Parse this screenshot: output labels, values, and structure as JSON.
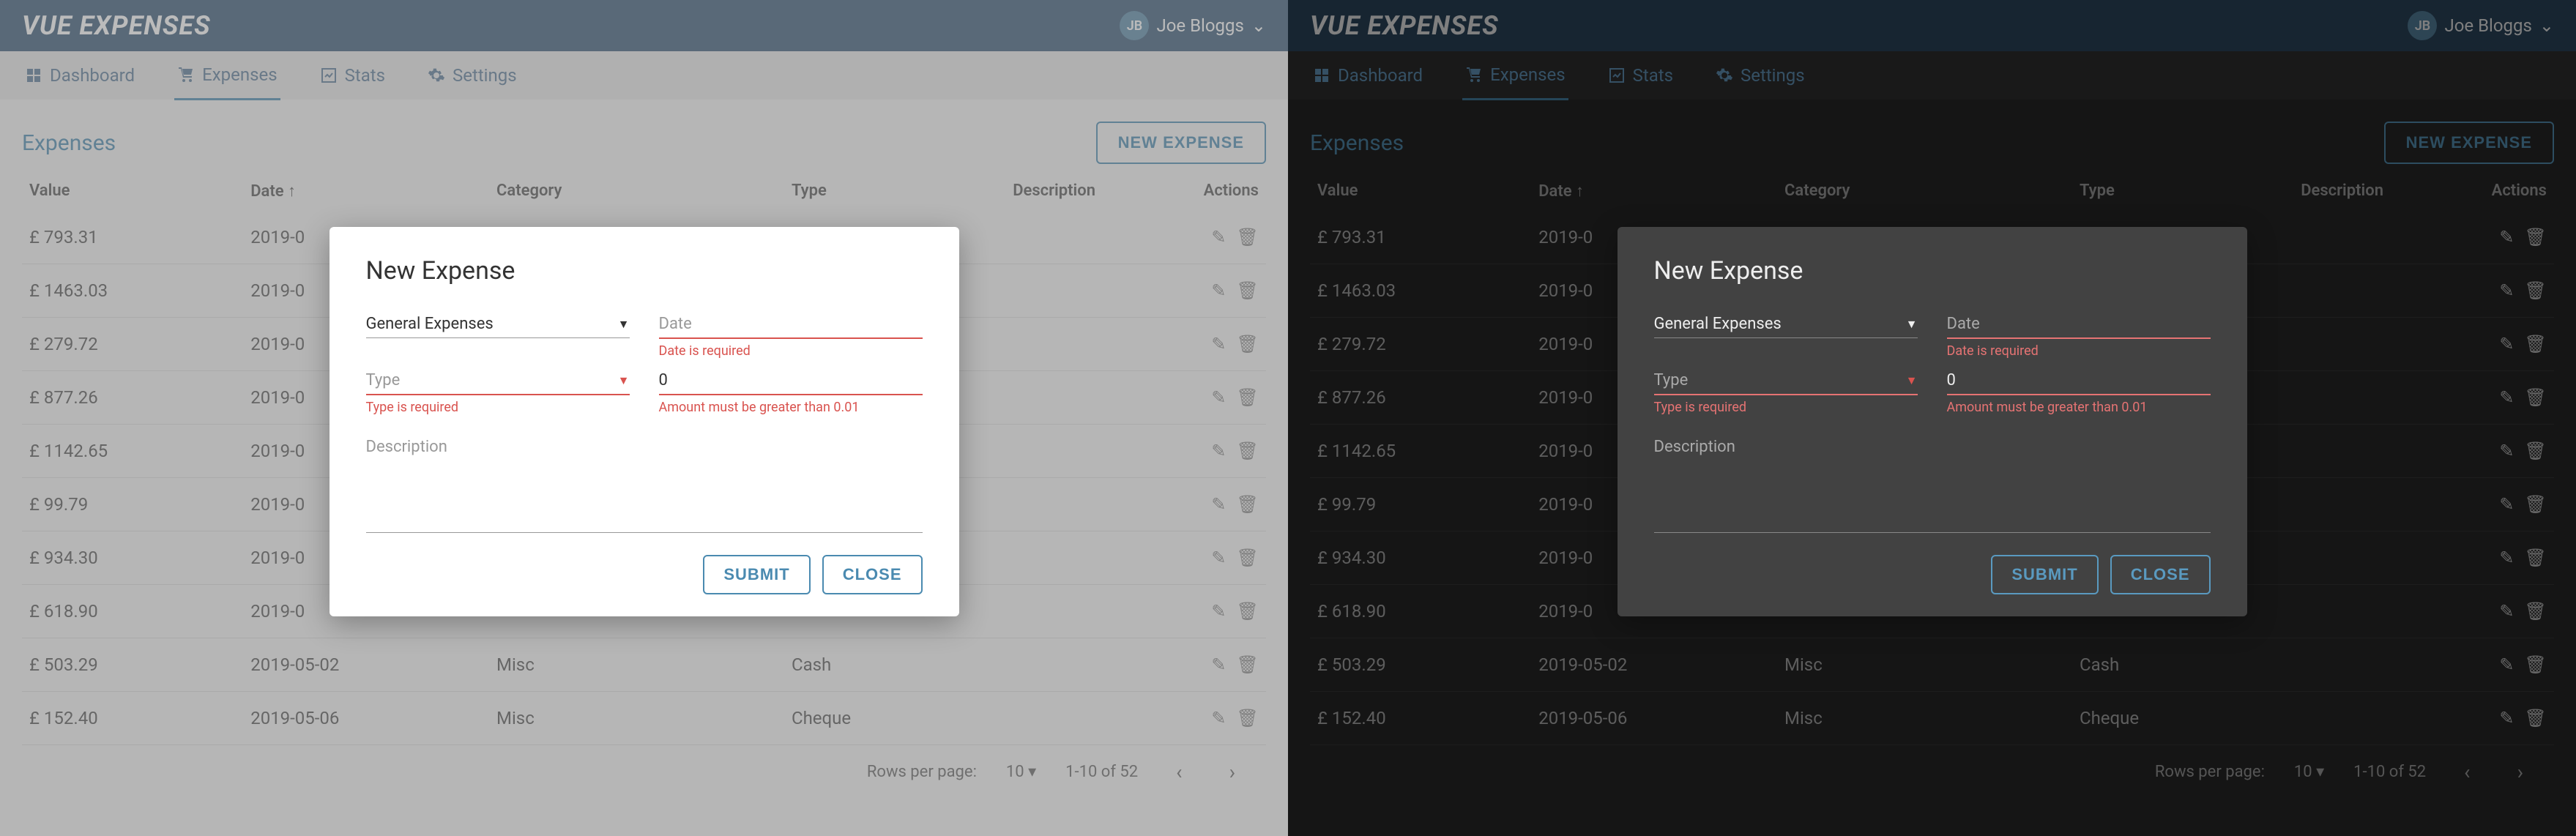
{
  "brand": "VUE EXPENSES",
  "user": {
    "initials": "JB",
    "name": "Joe Bloggs"
  },
  "nav": [
    {
      "icon": "dashboard-icon",
      "label": "Dashboard"
    },
    {
      "icon": "cart-icon",
      "label": "Expenses"
    },
    {
      "icon": "stats-icon",
      "label": "Stats"
    },
    {
      "icon": "gear-icon",
      "label": "Settings"
    }
  ],
  "section_title": "Expenses",
  "new_button": "NEW EXPENSE",
  "columns": {
    "value": "Value",
    "date": "Date",
    "category": "Category",
    "type": "Type",
    "description": "Description",
    "actions": "Actions"
  },
  "sort": {
    "column": "date",
    "direction": "asc"
  },
  "currency": "£",
  "rows": [
    {
      "value": "£ 793.31",
      "date": "2019-0",
      "category": "",
      "type": ""
    },
    {
      "value": "£ 1463.03",
      "date": "2019-0",
      "category": "",
      "type": ""
    },
    {
      "value": "£ 279.72",
      "date": "2019-0",
      "category": "",
      "type": ""
    },
    {
      "value": "£ 877.26",
      "date": "2019-0",
      "category": "",
      "type": ""
    },
    {
      "value": "£ 1142.65",
      "date": "2019-0",
      "category": "",
      "type": ""
    },
    {
      "value": "£ 99.79",
      "date": "2019-0",
      "category": "",
      "type": ""
    },
    {
      "value": "£ 934.30",
      "date": "2019-0",
      "category": "",
      "type": ""
    },
    {
      "value": "£ 618.90",
      "date": "2019-0",
      "category": "",
      "type": ""
    },
    {
      "value": "£ 503.29",
      "date": "2019-05-02",
      "category": "Misc",
      "type": "Cash"
    },
    {
      "value": "£ 152.40",
      "date": "2019-05-06",
      "category": "Misc",
      "type": "Cheque"
    }
  ],
  "pager": {
    "rows_label": "Rows per page:",
    "rows_per_page": "10",
    "range": "1-10 of 52"
  },
  "modal": {
    "title": "New Expense",
    "category": {
      "label": "General Expenses",
      "value": "General Expenses",
      "error": ""
    },
    "date": {
      "label": "Date",
      "value": "",
      "error": "Date is required"
    },
    "type": {
      "label": "Type",
      "value": "",
      "error": "Type is required"
    },
    "amount": {
      "label": "",
      "value": "0",
      "error": "Amount must be greater than 0.01"
    },
    "description": {
      "label": "Description",
      "value": ""
    },
    "submit": "SUBMIT",
    "close": "CLOSE"
  }
}
